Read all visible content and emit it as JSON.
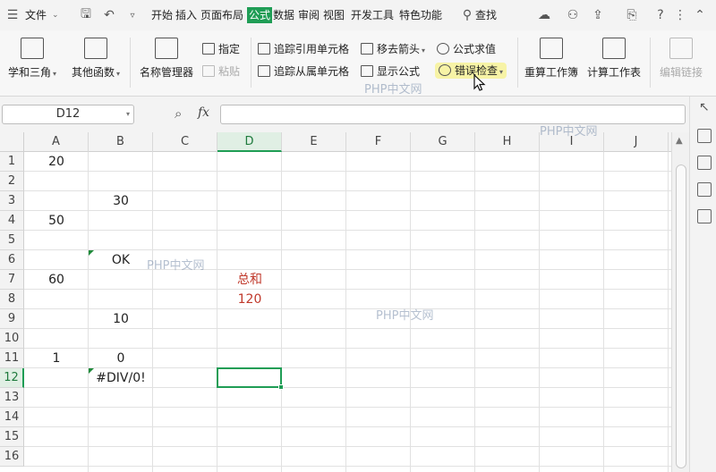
{
  "menubar": {
    "file_label": "文件",
    "tabs": [
      "开始",
      "插入",
      "页面布局",
      "公式",
      "数据",
      "审阅",
      "视图",
      "开发工具",
      "特色功能"
    ],
    "active_tab": "公式",
    "search_label": "查找"
  },
  "ribbon": {
    "math_trig": "学和三角",
    "other_functions": "其他函数",
    "name_manager": "名称管理器",
    "define_name": "指定",
    "paste_name": "粘贴",
    "trace_precedents": "追踪引用单元格",
    "trace_dependents": "追踪从属单元格",
    "remove_arrows": "移去箭头",
    "show_formulas": "显示公式",
    "evaluate_formula": "公式求值",
    "error_checking": "错误检查",
    "recalc_workbook": "重算工作簿",
    "calc_sheet": "计算工作表",
    "edit_links": "编辑链接"
  },
  "formula_bar": {
    "name_box": "D12",
    "fx_label": "fx",
    "formula": ""
  },
  "grid": {
    "columns": [
      "A",
      "B",
      "C",
      "D",
      "E",
      "F",
      "G",
      "H",
      "I",
      "J"
    ],
    "rows": [
      "1",
      "2",
      "3",
      "4",
      "5",
      "6",
      "7",
      "8",
      "9",
      "10",
      "11",
      "12",
      "13",
      "14",
      "15",
      "16"
    ],
    "selected_cell": "D12",
    "cells": {
      "A1": "20",
      "B3": "30",
      "A4": "50",
      "B6": "OK",
      "A7": "60",
      "D7": "总和",
      "D8": "120",
      "B9": "10",
      "A11": "1",
      "B11": "0",
      "B12": "#DIV/0!"
    }
  },
  "watermark": "PHP中文网",
  "colors": {
    "accent": "#1f9d55",
    "result_red": "#c0392b"
  }
}
